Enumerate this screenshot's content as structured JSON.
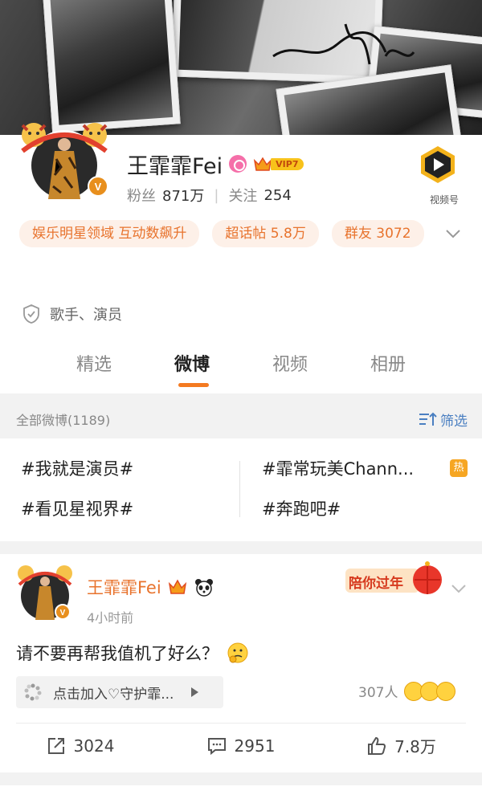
{
  "profile": {
    "name": "王霏霏Fei",
    "vip_level": "VIP7",
    "fans_label": "粉丝",
    "fans_count": "871万",
    "following_label": "关注",
    "following_count": "254",
    "video_channel_label": "视频号",
    "tags": [
      "娱乐明星领域 互动数飙升",
      "超话帖 5.8万",
      "群友 3072"
    ],
    "bio": "歌手、演员"
  },
  "tabs": [
    {
      "label": "精选",
      "active": false
    },
    {
      "label": "微博",
      "active": true
    },
    {
      "label": "视频",
      "active": false
    },
    {
      "label": "相册",
      "active": false
    }
  ],
  "filter_bar": {
    "all_weibo": "全部微博(1189)",
    "filter_label": "筛选"
  },
  "topics": [
    "#我就是演员#",
    "#霏常玩美Chann...",
    "#看见星视界#",
    "#奔跑吧#"
  ],
  "hot_badge": "热",
  "post": {
    "author": "王霏霏Fei",
    "time": "4小时前",
    "decoration_text": "陪你过年",
    "text": "请不要再帮我值机了好么？",
    "guard_text": "点击加入♡守护霏...",
    "reaction_count": "307人",
    "repost_count": "3024",
    "comment_count": "2951",
    "like_count": "7.8万"
  },
  "colors": {
    "accent_orange": "#f47a20",
    "link_blue": "#4a7fc1",
    "tag_bg": "#fdf0e8",
    "tag_text": "#e8732d"
  }
}
